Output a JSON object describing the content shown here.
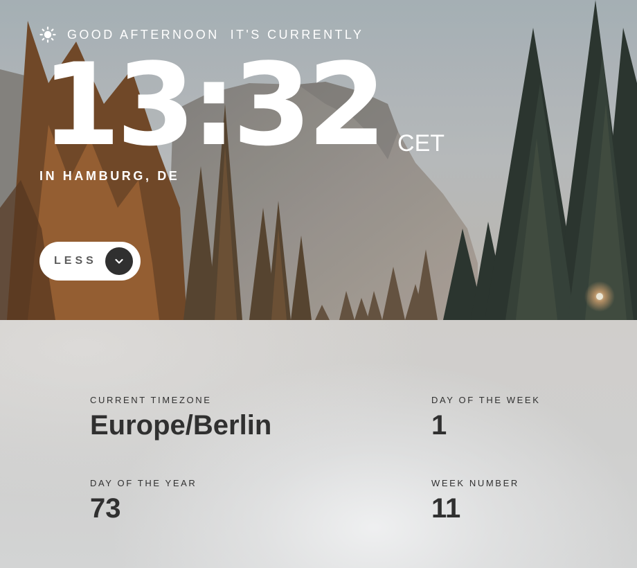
{
  "greeting": {
    "icon": "sun-icon",
    "text": "GOOD AFTERNOON",
    "suffix": "IT'S CURRENTLY"
  },
  "clock": {
    "time": "13:32",
    "timezone_abbr": "CET"
  },
  "location": "IN HAMBURG, DE",
  "toggle": {
    "label": "LESS",
    "icon": "chevron-down-icon"
  },
  "details": {
    "current_timezone": {
      "label": "CURRENT TIMEZONE",
      "value": "Europe/Berlin"
    },
    "day_of_week": {
      "label": "DAY OF THE WEEK",
      "value": "1"
    },
    "day_of_year": {
      "label": "DAY OF THE YEAR",
      "value": "73"
    },
    "week_number": {
      "label": "WEEK NUMBER",
      "value": "11"
    }
  },
  "colors": {
    "text_light": "#ffffff",
    "text_dark": "#303030",
    "button_bg": "#ffffff",
    "chevron_bg": "#303030"
  }
}
